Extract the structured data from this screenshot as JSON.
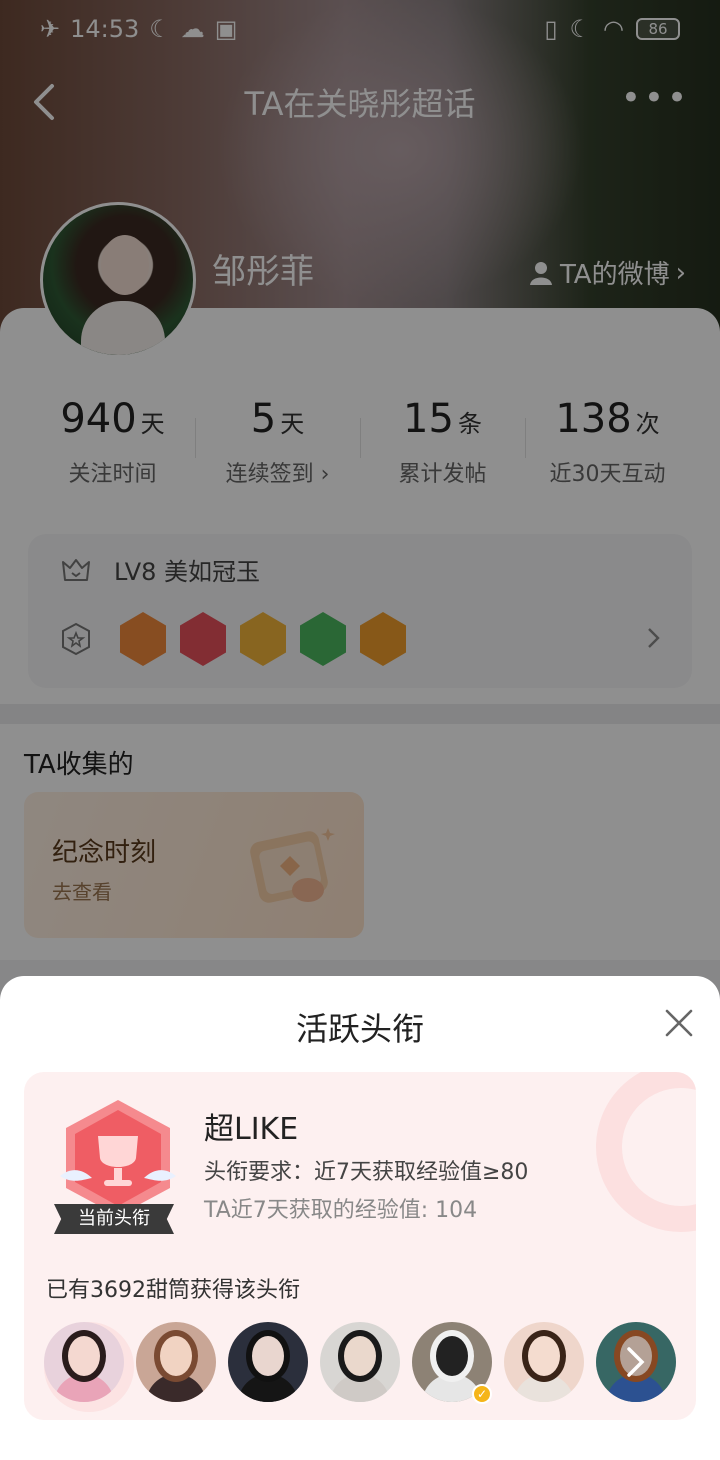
{
  "status_bar": {
    "time": "14:53",
    "battery": "86"
  },
  "nav": {
    "title": "TA在关晓彤超话"
  },
  "profile": {
    "name": "邹彤菲",
    "weibo_link": "TA的微博"
  },
  "stats": [
    {
      "value": "940",
      "unit": "天",
      "label": "关注时间"
    },
    {
      "value": "5",
      "unit": "天",
      "label": "连续签到 ›"
    },
    {
      "value": "15",
      "unit": "条",
      "label": "累计发帖"
    },
    {
      "value": "138",
      "unit": "次",
      "label": "近30天互动"
    }
  ],
  "level": {
    "text": "LV8 美如冠玉",
    "medals": [
      {
        "icon": "lv8-medal-icon",
        "color": "#f08a3c"
      },
      {
        "icon": "trophy-medal-icon",
        "color": "#e8505b"
      },
      {
        "icon": "hi-medal-icon",
        "color": "#f3b53a"
      },
      {
        "icon": "hand-medal-icon",
        "color": "#4cb85f"
      },
      {
        "icon": "face-medal-icon",
        "color": "#f09d2c"
      }
    ]
  },
  "collection": {
    "title": "TA收集的",
    "card_title": "纪念时刻",
    "card_sub": "去查看"
  },
  "sheet": {
    "title": "活跃头衔",
    "badge_name": "超LIKE",
    "current_label": "当前头衔",
    "requirement": "头衔要求：近7天获取经验值≥80",
    "exp": "TA近7天获取的经验值: 104",
    "holders": "已有3692甜筒获得该头衔",
    "users": [
      {
        "hair": "#2a1c1c",
        "face": "#f4d8d0",
        "body": "#e9a4b8",
        "bg": "#e8d2dc"
      },
      {
        "hair": "#7a4a32",
        "face": "#f1d3c2",
        "body": "#3a2a2a",
        "bg": "#c9a696"
      },
      {
        "hair": "#111111",
        "face": "#e9d6cf",
        "body": "#151515",
        "bg": "#2b2f3c"
      },
      {
        "hair": "#1a1a1a",
        "face": "#ead8cc",
        "body": "#cfcac6",
        "bg": "#d8d6d3"
      },
      {
        "hair": "#f0f0f0",
        "face": "#222222",
        "body": "#e6e6e6",
        "bg": "#8d8275",
        "vip": true
      },
      {
        "hair": "#3a2418",
        "face": "#f4dccf",
        "body": "#e9e2dc",
        "bg": "#efd6cb"
      },
      {
        "hair": "#b5602e",
        "face": "#f1d7c8",
        "body": "#3b6dc2",
        "bg": "#4a8a86",
        "more": true
      }
    ],
    "colors": {
      "accent": "#e8505b",
      "card_bg": "#fdf0f0"
    }
  }
}
